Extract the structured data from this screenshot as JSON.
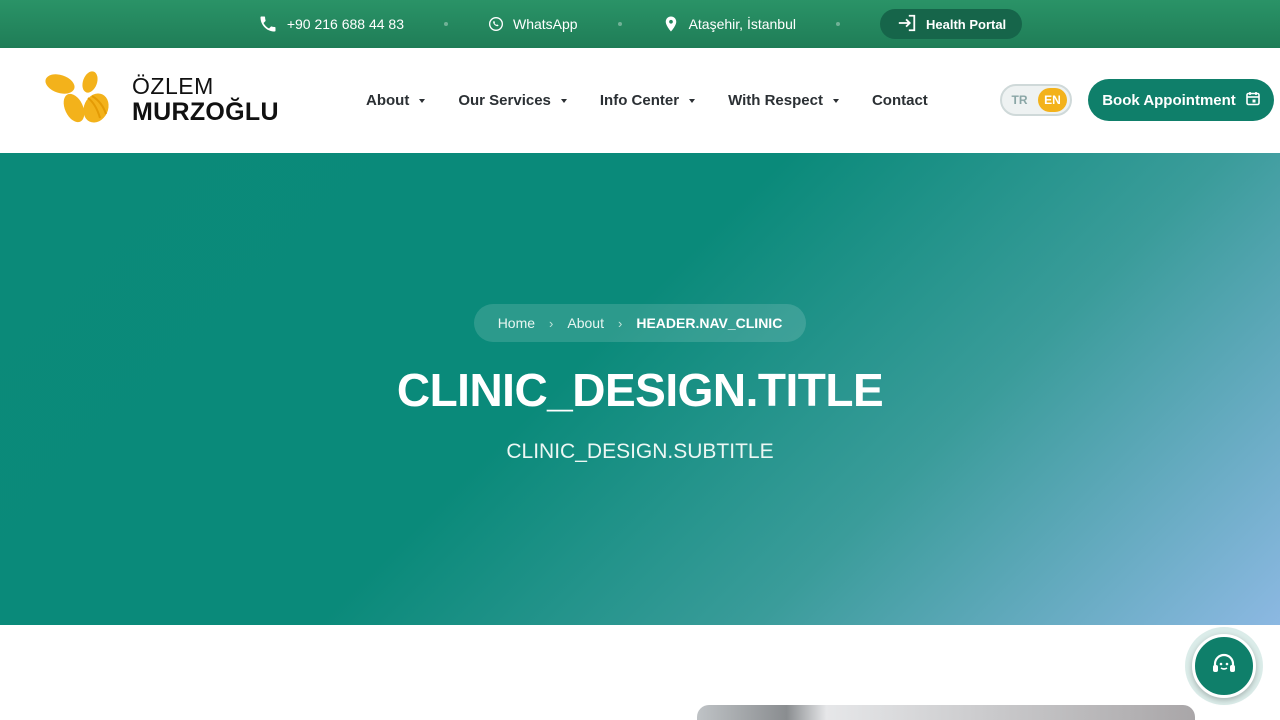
{
  "topbar": {
    "phone": "+90 216 688 44 83",
    "whatsapp": "WhatsApp",
    "location": "Ataşehir, İstanbul",
    "portal": "Health Portal"
  },
  "brand": {
    "line1": "ÖZLEM",
    "line2": "MURZOĞLU"
  },
  "nav": {
    "items": [
      {
        "label": "About",
        "dropdown": true
      },
      {
        "label": "Our Services",
        "dropdown": true
      },
      {
        "label": "Info Center",
        "dropdown": true
      },
      {
        "label": "With Respect",
        "dropdown": true
      },
      {
        "label": "Contact",
        "dropdown": false
      }
    ]
  },
  "language": {
    "options": [
      "TR",
      "EN"
    ],
    "selected": "EN"
  },
  "cta": {
    "book_label": "Book Appointment"
  },
  "hero": {
    "breadcrumb": [
      "Home",
      "About",
      "HEADER.NAV_CLINIC"
    ],
    "title": "CLINIC_DESIGN.TITLE",
    "subtitle": "CLINIC_DESIGN.SUBTITLE"
  },
  "colors": {
    "primary": "#0f7f6a",
    "topbar": "#24875f",
    "accent": "#f3b21b"
  },
  "icons": [
    "phone-icon",
    "whatsapp-icon",
    "location-pin-icon",
    "login-icon",
    "calendar-icon",
    "chevron-right-icon",
    "headset-icon"
  ]
}
